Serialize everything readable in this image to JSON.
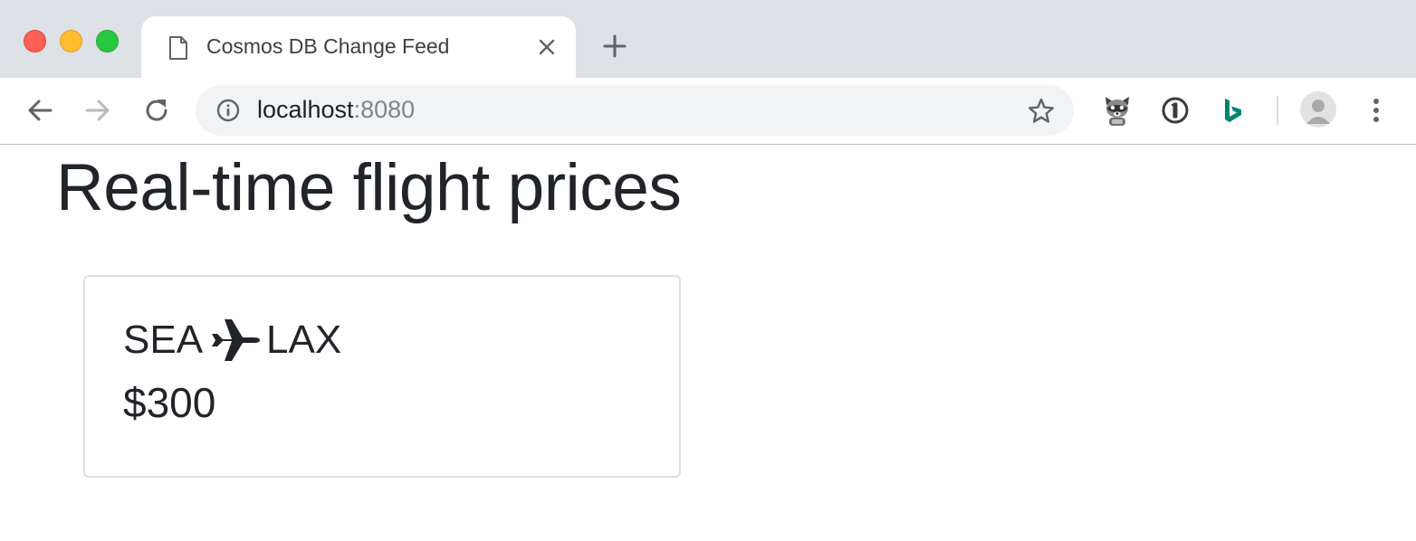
{
  "browser": {
    "tab": {
      "title": "Cosmos DB Change Feed"
    },
    "address_bar": {
      "host": "localhost",
      "port": ":8080"
    },
    "icons": {
      "tab_page": "page-icon",
      "tab_close": "close-icon",
      "new_tab": "plus-icon",
      "back": "arrow-left-icon",
      "forward": "arrow-right-icon",
      "reload": "reload-icon",
      "site_info": "info-icon",
      "bookmark": "star-icon",
      "extension_1": "raccoon-icon",
      "extension_2": "password-manager-icon",
      "extension_3": "bing-icon",
      "profile": "avatar-icon",
      "menu": "kebab-menu-icon"
    },
    "colors": {
      "tabstrip": "#dee1e6",
      "traffic_close": "#fe5f57",
      "traffic_minimize": "#febc2e",
      "traffic_maximize": "#28c840",
      "bing_teal": "#008373"
    }
  },
  "page": {
    "title": "Real-time flight prices",
    "flights": [
      {
        "origin": "SEA",
        "destination": "LAX",
        "price": "$300",
        "icon": "plane-icon"
      }
    ],
    "colors": {
      "text": "#212529",
      "card_border": "#dfdfdf"
    }
  }
}
